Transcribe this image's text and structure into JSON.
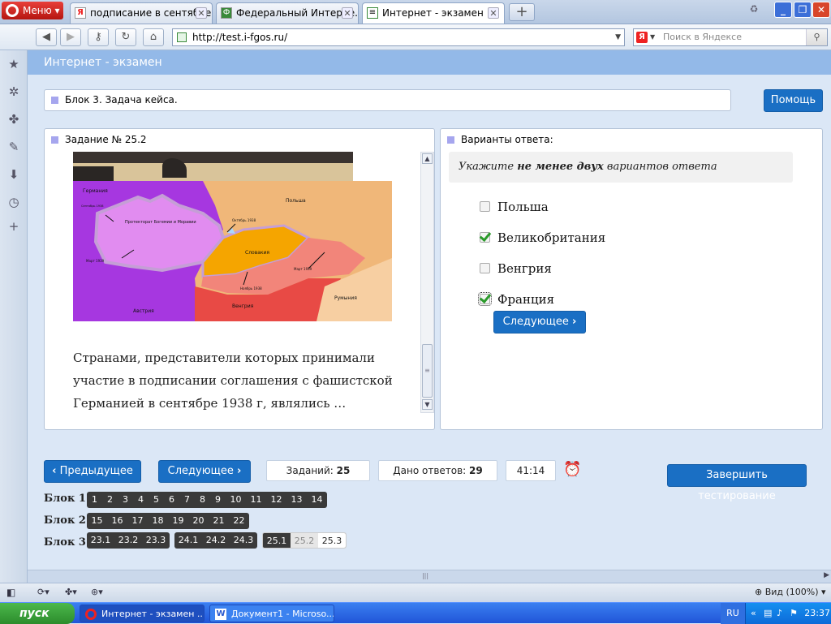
{
  "browser": {
    "menu_label": "Меню",
    "tabs": [
      {
        "label": "подписание в сентябре...",
        "icon": "yandex-icon"
      },
      {
        "label": "Федеральный Интерне...",
        "icon": "site-icon"
      },
      {
        "label": "Интернет - экзамен",
        "icon": "page-icon"
      }
    ],
    "url": "http://test.i-fgos.ru/",
    "search_placeholder": "Поиск в Яндексе",
    "search_logo": "Я"
  },
  "page": {
    "header_title": "Интернет - экзамен",
    "block_title": "Блок 3. Задача кейса.",
    "help_label": "Помощь",
    "task_title": "Задание № 25.2",
    "map_labels": {
      "germany": "Германия",
      "poland": "Польша",
      "protectorate": "Протекторат Богемии и Моравии",
      "slovakia": "Словакия",
      "hungary": "Венгрия",
      "austria": "Австрия",
      "romania": "Румыния",
      "date_oct": "Октябрь 1938",
      "date_mar1": "Март 1939",
      "date_mar2": "Март 1939",
      "date_nov": "Ноябрь 1938",
      "date_sept": "Сентябрь 1938"
    },
    "question_text": "Странами, представители которых принимали участие в подписании соглашения с фашистской Германией в сентябре 1938 г, являлись …",
    "answers_title": "Варианты ответа:",
    "instruction_pre": "Укажите ",
    "instruction_bold": "не менее двух",
    "instruction_post": " вариантов ответа",
    "options": [
      {
        "label": "Польша",
        "checked": false
      },
      {
        "label": "Великобритания",
        "checked": true
      },
      {
        "label": "Венгрия",
        "checked": false
      },
      {
        "label": "Франция",
        "checked": true
      }
    ],
    "next_inline_label": "Следующее",
    "prev_label": "Предыдущее",
    "next_label": "Следующее",
    "tasks_label": "Заданий:",
    "tasks_count": "25",
    "answers_label": "Дано ответов:",
    "answers_count": "29",
    "timer": "41:14",
    "finish_label": "Завершить тестирование",
    "blocks": [
      {
        "label": "Блок 1",
        "items": [
          "1",
          "2",
          "3",
          "4",
          "5",
          "6",
          "7",
          "8",
          "9",
          "10",
          "11",
          "12",
          "13",
          "14"
        ]
      },
      {
        "label": "Блок 2",
        "items": [
          "15",
          "16",
          "17",
          "18",
          "19",
          "20",
          "21",
          "22"
        ]
      },
      {
        "label": "Блок 3",
        "groups": [
          [
            "23.1",
            "23.2",
            "23.3"
          ],
          [
            "24.1",
            "24.2",
            "24.3"
          ],
          [
            "25.1",
            "25.2",
            "25.3"
          ]
        ]
      }
    ]
  },
  "status": {
    "zoom": "Вид (100%)"
  },
  "taskbar": {
    "start_label": "пуск",
    "tasks": [
      "Интернет - экзамен ...",
      "Документ1 - Microso..."
    ],
    "lang": "RU",
    "time": "23:37"
  }
}
